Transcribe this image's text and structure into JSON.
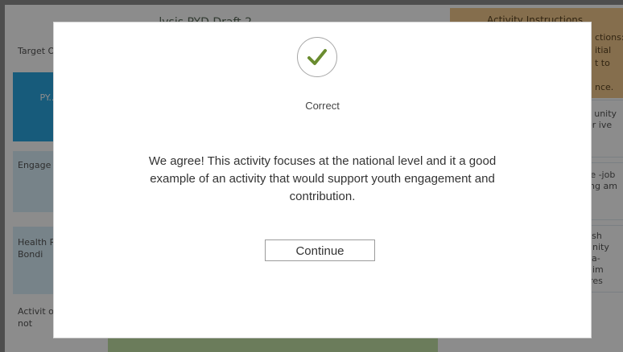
{
  "background": {
    "heading": "...lysis PYD Draft 2...",
    "instructions": {
      "title": "Activity Instructions",
      "lines": [
        "ctions:",
        "itial",
        "t to",
        "nce."
      ]
    },
    "left_column": [
      {
        "label": "Target Outco",
        "style": "plain"
      },
      {
        "label": "PY... wa...",
        "style": "blue"
      },
      {
        "label": "Engage and Contri",
        "style": "pale"
      },
      {
        "label": "Health Relatio / Bondi",
        "style": "pale"
      },
      {
        "label": "Activit option do not",
        "style": "plain"
      }
    ],
    "right_column": [
      {
        "label": "s unity er ive"
      },
      {
        "label": "te -job ing am"
      },
      {
        "label": "lish unity ca- nim ires"
      }
    ]
  },
  "modal": {
    "icon": "checkmark-icon",
    "result": "Correct",
    "feedback": "We agree! This activity focuses at the national level and it a good example of an activity that would support youth engagement and contribution.",
    "continue_label": "Continue"
  },
  "colors": {
    "check": "#6a8c2f",
    "instructions_bg": "#f2c98d",
    "accent_blue": "#2aa6e0",
    "pale_blue": "#d9effa",
    "green_bar": "#c4e2a6"
  }
}
